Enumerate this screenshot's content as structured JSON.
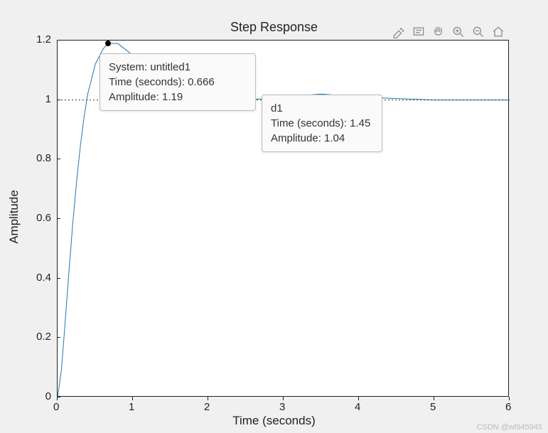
{
  "title": "Step Response",
  "xlabel": "Time (seconds)",
  "ylabel": "Amplitude",
  "xticks": [
    "0",
    "1",
    "2",
    "3",
    "4",
    "5",
    "6"
  ],
  "yticks": [
    "0",
    "0.2",
    "0.4",
    "0.6",
    "0.8",
    "1",
    "1.2"
  ],
  "watermark": "CSDN @wl945945",
  "toolbar": {
    "brush": "brush-icon",
    "datatip": "datatip-icon",
    "pan": "pan-icon",
    "zoomin": "zoom-in-icon",
    "zoomout": "zoom-out-icon",
    "home": "home-icon"
  },
  "datatips": [
    {
      "system_label": "System:",
      "system": "untitled1",
      "time_label": "Time (seconds):",
      "time": "0.666",
      "amp_label": "Amplitude:",
      "amp": "1.19"
    },
    {
      "system_end": "d1",
      "time_label": "Time (seconds):",
      "time": "1.45",
      "amp_label": "Amplitude:",
      "amp": "1.04"
    }
  ],
  "chart_data": {
    "type": "line",
    "title": "Step Response",
    "xlabel": "Time (seconds)",
    "ylabel": "Amplitude",
    "xlim": [
      0,
      6
    ],
    "ylim": [
      0,
      1.2
    ],
    "reference_line": 1.0,
    "series": [
      {
        "name": "untitled1",
        "x": [
          0,
          0.05,
          0.1,
          0.15,
          0.2,
          0.25,
          0.3,
          0.35,
          0.4,
          0.5,
          0.6,
          0.666,
          0.8,
          1.0,
          1.2,
          1.45,
          1.7,
          2.0,
          2.5,
          3.0,
          3.5,
          4.0,
          5.0,
          6.0
        ],
        "y": [
          0.0,
          0.09,
          0.25,
          0.42,
          0.58,
          0.72,
          0.84,
          0.94,
          1.02,
          1.12,
          1.17,
          1.19,
          1.19,
          1.15,
          1.1,
          1.04,
          1.01,
          1.0,
          1.0,
          1.01,
          1.02,
          1.01,
          1.0,
          1.0
        ]
      }
    ],
    "markers": [
      {
        "x": 0.666,
        "y": 1.19
      }
    ]
  }
}
